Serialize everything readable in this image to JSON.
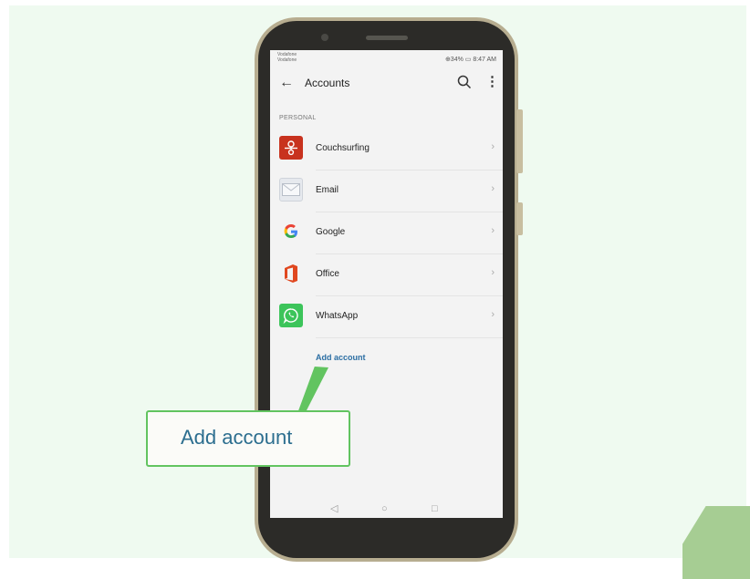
{
  "status": {
    "carrier_1": "Vodafone",
    "carrier_2": "Vodafone",
    "right_text": "⊕34% ▭ 8:47 AM"
  },
  "appbar": {
    "title": "Accounts",
    "back_icon": "arrow-left-icon",
    "search_icon": "search-icon",
    "more_icon": "more-vertical-icon"
  },
  "section": {
    "label": "PERSONAL"
  },
  "accounts": [
    {
      "label": "Couchsurfing",
      "icon": "couchsurfing-icon",
      "color": "#c8321e"
    },
    {
      "label": "Email",
      "icon": "email-icon",
      "color": "#e6e9ee"
    },
    {
      "label": "Google",
      "icon": "google-icon",
      "color": "#ffffff"
    },
    {
      "label": "Office",
      "icon": "office-icon",
      "color": "#e0471f"
    },
    {
      "label": "WhatsApp",
      "icon": "whatsapp-icon",
      "color": "#3cc45a"
    }
  ],
  "chevron": "›",
  "add_account": {
    "label": "Add account"
  },
  "navbar": {
    "back": "◁",
    "home": "○",
    "recent": "□"
  },
  "callout": {
    "text": "Add account",
    "border_color": "#62c460",
    "text_color": "#2c6e8f"
  }
}
